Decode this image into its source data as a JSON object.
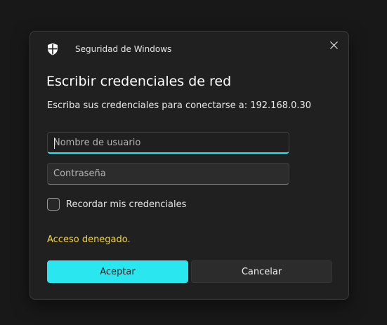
{
  "dialog": {
    "window_title": "Seguridad de Windows",
    "heading": "Escribir credenciales de red",
    "description": "Escriba sus credenciales para conectarse a: 192.168.0.30",
    "username": {
      "value": "",
      "placeholder": "Nombre de usuario"
    },
    "password": {
      "value": "",
      "placeholder": "Contraseña"
    },
    "remember": {
      "label": "Recordar mis credenciales",
      "checked": false
    },
    "error": "Acceso denegado.",
    "accept_label": "Aceptar",
    "cancel_label": "Cancelar"
  },
  "icons": {
    "app": "shield-icon",
    "close": "close-icon"
  },
  "colors": {
    "accent": "#2ae6ef",
    "error": "#f2d43a",
    "dialog_bg": "#202020",
    "page_bg": "#181818"
  }
}
